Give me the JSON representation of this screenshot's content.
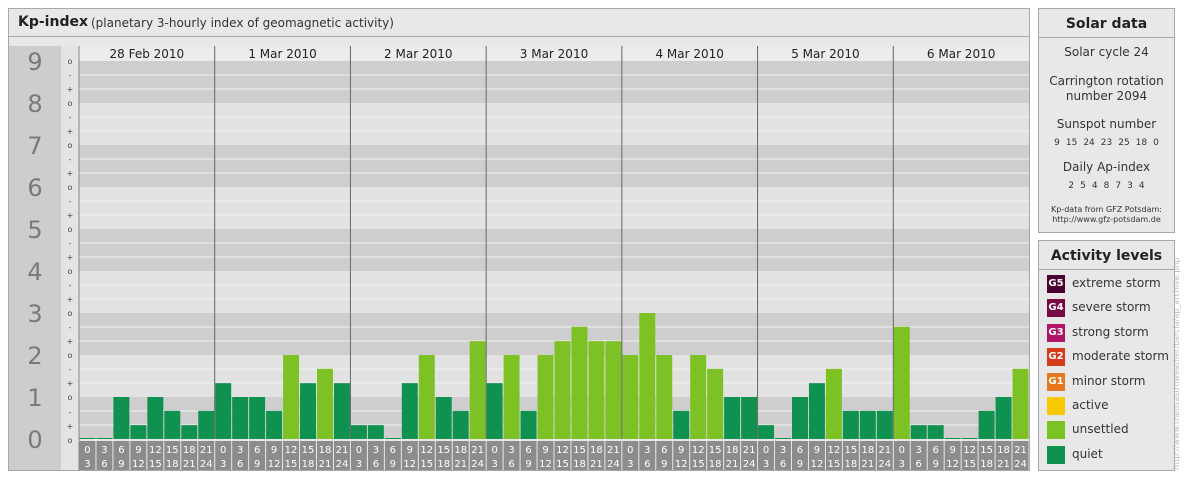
{
  "header": {
    "title": "Kp-index",
    "subtitle": "(planetary 3-hourly index of geomagnetic activity)"
  },
  "chart_data": {
    "type": "bar",
    "title": "Kp-index",
    "subtitle": "(planetary 3-hourly index of geomagnetic activity)",
    "days": [
      "28 Feb 2010",
      "1 Mar 2010",
      "2 Mar 2010",
      "3 Mar 2010",
      "4 Mar 2010",
      "5 Mar 2010",
      "6 Mar 2010"
    ],
    "time_slots": [
      {
        "start": "0",
        "end": "3"
      },
      {
        "start": "3",
        "end": "6"
      },
      {
        "start": "6",
        "end": "9"
      },
      {
        "start": "9",
        "end": "12"
      },
      {
        "start": "12",
        "end": "15"
      },
      {
        "start": "15",
        "end": "18"
      },
      {
        "start": "18",
        "end": "21"
      },
      {
        "start": "21",
        "end": "24"
      }
    ],
    "values": [
      0.0,
      0.0,
      1.0,
      0.33,
      1.0,
      0.67,
      0.33,
      0.67,
      1.33,
      1.0,
      1.0,
      0.67,
      2.0,
      1.33,
      1.67,
      1.33,
      0.33,
      0.33,
      0.0,
      1.33,
      2.0,
      1.0,
      0.67,
      2.33,
      1.33,
      2.0,
      0.67,
      2.0,
      2.33,
      2.67,
      2.33,
      2.33,
      2.0,
      3.0,
      2.0,
      0.67,
      2.0,
      1.67,
      1.0,
      1.0,
      0.33,
      0.0,
      1.0,
      1.33,
      1.67,
      0.67,
      0.67,
      0.67,
      2.67,
      0.33,
      0.33,
      0.0,
      0.0,
      0.67,
      1.0,
      1.67
    ],
    "ylim": [
      0,
      9
    ],
    "y_ticks": [
      "0",
      "1",
      "2",
      "3",
      "4",
      "5",
      "6",
      "7",
      "8",
      "9"
    ],
    "sub_ticks": [
      "-",
      "o",
      "+"
    ],
    "colors": {
      "quiet": "#0f9150",
      "unsettled": "#7dc224",
      "active": "#f8c800",
      "band_dark": "#cecece",
      "band_light": "#e2e2e2",
      "slot_label_bg": "#8c8c8c",
      "y_label_bg": "#cdcdcd",
      "y_label_text": "#7a7a7a"
    }
  },
  "solar_data": {
    "title": "Solar data",
    "solar_cycle": "Solar cycle 24",
    "carrington_line1": "Carrington rotation",
    "carrington_line2": "number 2094",
    "sunspot_label": "Sunspot number",
    "sunspot_values": [
      "9",
      "15",
      "24",
      "23",
      "25",
      "18",
      "0"
    ],
    "ap_label": "Daily Ap-index",
    "ap_values": [
      "2",
      "5",
      "4",
      "8",
      "7",
      "3",
      "4"
    ],
    "source_line1": "Kp-data from GFZ Potsdam:",
    "source_line2": "http://www.gfz-potsdam.de"
  },
  "activity_levels": {
    "title": "Activity levels",
    "items": [
      {
        "badge": "G5",
        "label": "extreme storm",
        "color": "#4a0030"
      },
      {
        "badge": "G4",
        "label": "severe storm",
        "color": "#7a0a44"
      },
      {
        "badge": "G3",
        "label": "strong storm",
        "color": "#b01565"
      },
      {
        "badge": "G2",
        "label": "moderate storm",
        "color": "#d63c1b"
      },
      {
        "badge": "G1",
        "label": "minor storm",
        "color": "#e8781e"
      },
      {
        "badge": "",
        "label": "active",
        "color": "#f8c800"
      },
      {
        "badge": "",
        "label": "unsettled",
        "color": "#7dc224"
      },
      {
        "badge": "",
        "label": "quiet",
        "color": "#0f9150"
      }
    ]
  },
  "source_url": "http://www.theusastroweather/barcia/ap_archive.php"
}
